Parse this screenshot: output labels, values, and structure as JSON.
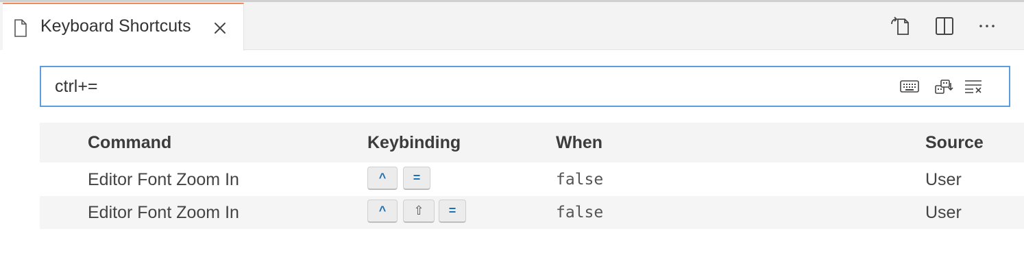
{
  "tab": {
    "label": "Keyboard Shortcuts",
    "icon": "file-icon",
    "close_icon": "close-icon",
    "accent_color": "#f08c5a"
  },
  "editor_actions": [
    {
      "name": "open-keyboard-shortcuts-json-icon"
    },
    {
      "name": "split-editor-icon"
    },
    {
      "name": "more-actions-icon",
      "label": "···"
    }
  ],
  "search": {
    "value": "ctrl+=",
    "placeholder": "",
    "border_color": "#5b9be0",
    "buttons": [
      {
        "name": "record-keys-icon"
      },
      {
        "name": "sort-by-precedence-icon"
      },
      {
        "name": "clear-search-icon"
      }
    ]
  },
  "table": {
    "columns": {
      "command": "Command",
      "keybinding": "Keybinding",
      "when": "When",
      "source": "Source"
    },
    "rows": [
      {
        "command": "Editor Font Zoom In",
        "keys": [
          "^",
          "="
        ],
        "when": "false",
        "source": "User"
      },
      {
        "command": "Editor Font Zoom In",
        "keys": [
          "^",
          "⇧",
          "="
        ],
        "when": "false",
        "source": "User"
      }
    ]
  }
}
